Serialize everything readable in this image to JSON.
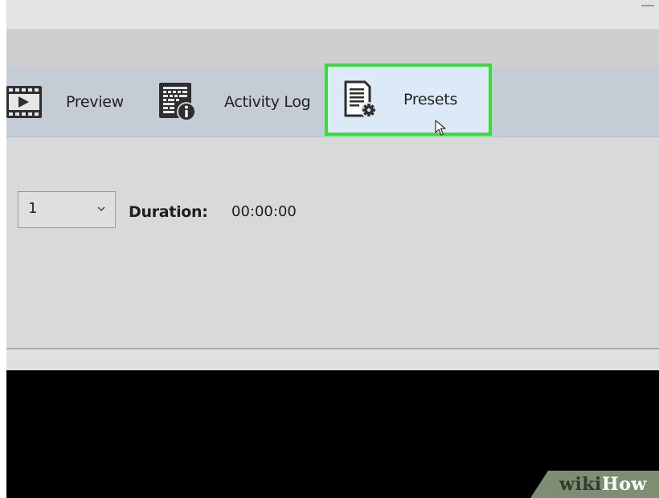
{
  "toolbar": {
    "preview": {
      "label": "Preview",
      "icon": "film-icon"
    },
    "activity_log": {
      "label": "Activity Log",
      "icon": "log-info-icon"
    },
    "presets": {
      "label": "Presets",
      "icon": "document-gear-icon",
      "highlight_color": "#3bdb3b"
    }
  },
  "controls": {
    "select_value": "1",
    "duration_label": "Duration:",
    "duration_value": "00:00:00"
  },
  "watermark": {
    "part1": "wiki",
    "part2": "How"
  }
}
